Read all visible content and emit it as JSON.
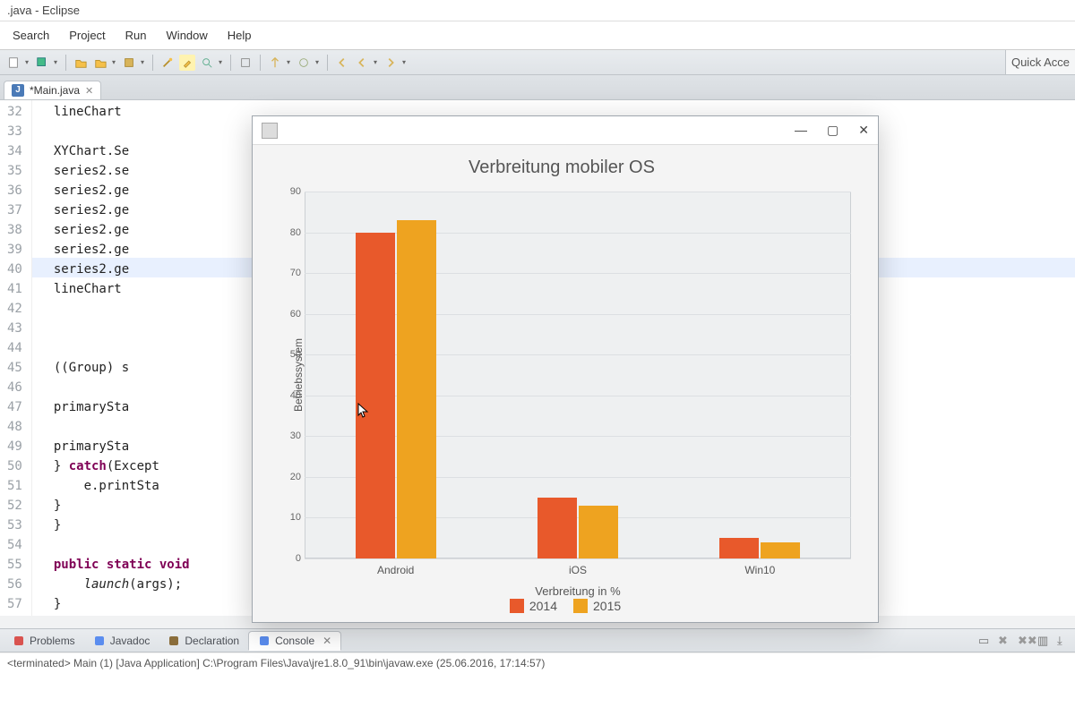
{
  "titlebar": ".java - Eclipse",
  "menu": [
    "Search",
    "Project",
    "Run",
    "Window",
    "Help"
  ],
  "quick_access": "Quick Acce",
  "editor_tab": "*Main.java",
  "line_start": 32,
  "highlighted_line": 40,
  "code_lines": [
    "lineChart",
    "",
    "XYChart.Se                                                                       >();",
    "series2.se",
    "series2.ge",
    "series2.ge",
    "series2.ge",
    "series2.ge",
    "series2.ge",
    "lineChart",
    "",
    "",
    "",
    "((Group) s",
    "",
    "primarySta",
    "",
    "primarySta",
    "} <kw>catch</kw>(Except",
    "    e.printSta",
    "}",
    "}",
    "",
    "<kw>public static void</kw>",
    "    <fn>launch</fn>(args);",
    "}"
  ],
  "bottom_tabs": {
    "items": [
      {
        "label": "Problems",
        "icon": "problems"
      },
      {
        "label": "Javadoc",
        "icon": "javadoc"
      },
      {
        "label": "Declaration",
        "icon": "declaration"
      },
      {
        "label": "Console",
        "icon": "console",
        "active": true
      }
    ]
  },
  "console_line": "<terminated> Main (1) [Java Application] C:\\Program Files\\Java\\jre1.8.0_91\\bin\\javaw.exe (25.06.2016, 17:14:57)",
  "chart_window": {
    "min": "—",
    "max": "▢",
    "close": "✕"
  },
  "chart_data": {
    "type": "bar",
    "title": "Verbreitung mobiler OS",
    "xlabel": "Verbreitung in %",
    "ylabel": "Betriebssystem",
    "categories": [
      "Android",
      "iOS",
      "Win10"
    ],
    "series": [
      {
        "name": "2014",
        "values": [
          80,
          15,
          5
        ]
      },
      {
        "name": "2015",
        "values": [
          83,
          13,
          4
        ]
      }
    ],
    "yticks": [
      0,
      10,
      20,
      30,
      40,
      50,
      60,
      70,
      80,
      90
    ],
    "ylim": [
      0,
      90
    ],
    "colors": [
      "#e8592b",
      "#eea320"
    ]
  }
}
